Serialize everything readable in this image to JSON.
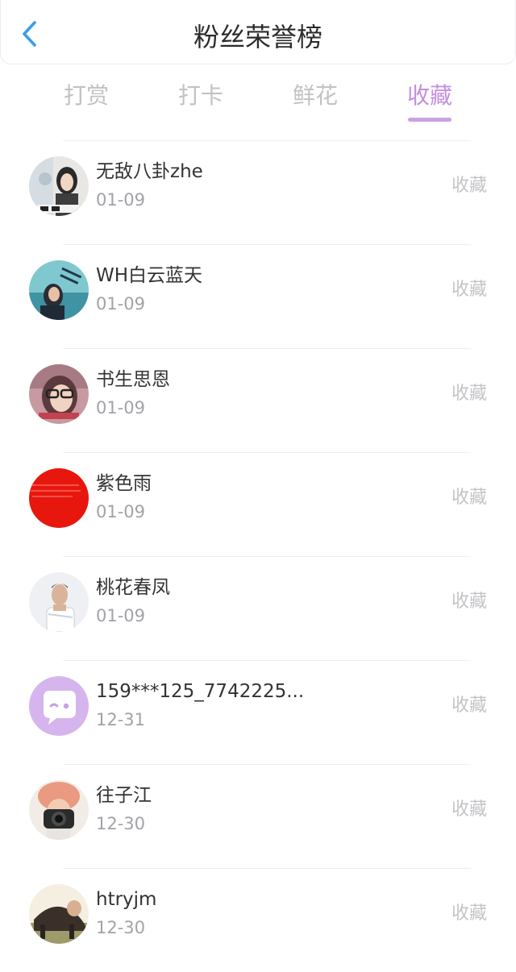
{
  "header": {
    "title": "粉丝荣誉榜",
    "back_icon": "chevron-left-icon",
    "accent_color": "#3a9ee6"
  },
  "tabs": [
    {
      "label": "打赏",
      "active": false
    },
    {
      "label": "打卡",
      "active": false
    },
    {
      "label": "鲜花",
      "active": false
    },
    {
      "label": "收藏",
      "active": true
    }
  ],
  "colors": {
    "tab_active": "#c48ee0",
    "tab_inactive": "#c2c2c6"
  },
  "fans": [
    {
      "name": "无敌八卦zhe",
      "date": "01-09",
      "action": "收藏"
    },
    {
      "name": "WH白云蓝天",
      "date": "01-09",
      "action": "收藏"
    },
    {
      "name": "书生思恩",
      "date": "01-09",
      "action": "收藏"
    },
    {
      "name": "紫色雨",
      "date": "01-09",
      "action": "收藏",
      "avatar_text": "If you wake of the feel of yourself / make me smile"
    },
    {
      "name": "桃花春凤",
      "date": "01-09",
      "action": "收藏"
    },
    {
      "name": "159***125_7742225...",
      "date": "12-31",
      "action": "收藏"
    },
    {
      "name": "往子江",
      "date": "12-30",
      "action": "收藏"
    },
    {
      "name": "htryjm",
      "date": "12-30",
      "action": "收藏"
    }
  ]
}
